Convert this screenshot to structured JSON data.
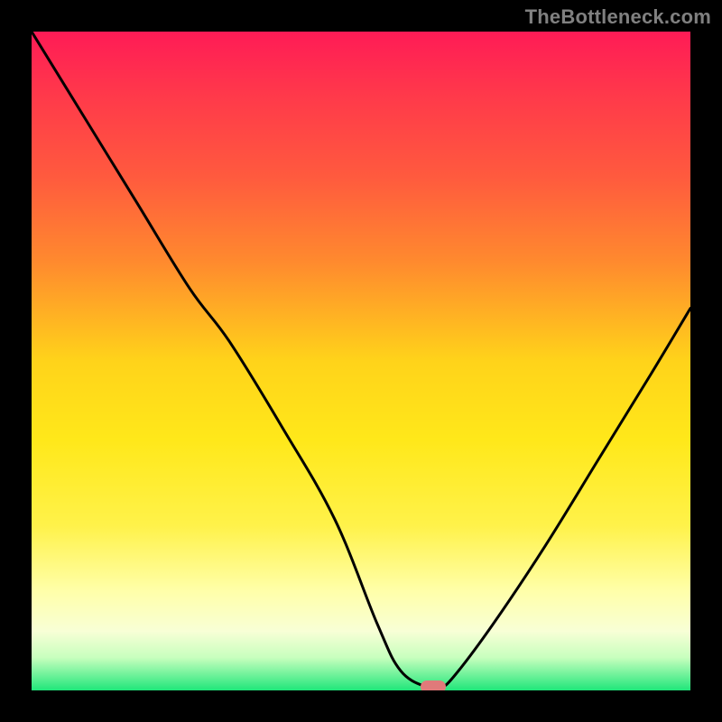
{
  "watermark": {
    "text": "TheBottleneck.com"
  },
  "colors": {
    "black": "#000000",
    "curve": "#000000",
    "marker": "#e07a7a",
    "gradient_stops": [
      {
        "pct": 0,
        "color": "#ff1b56"
      },
      {
        "pct": 10,
        "color": "#ff3a4a"
      },
      {
        "pct": 22,
        "color": "#ff5a3e"
      },
      {
        "pct": 35,
        "color": "#ff8a2e"
      },
      {
        "pct": 50,
        "color": "#ffd31a"
      },
      {
        "pct": 62,
        "color": "#ffe81a"
      },
      {
        "pct": 75,
        "color": "#fff24a"
      },
      {
        "pct": 85,
        "color": "#ffffaa"
      },
      {
        "pct": 91,
        "color": "#f8ffd6"
      },
      {
        "pct": 95,
        "color": "#c8ffbe"
      },
      {
        "pct": 100,
        "color": "#20e67a"
      }
    ]
  },
  "chart_data": {
    "type": "line",
    "title": "",
    "xlabel": "",
    "ylabel": "",
    "xlim": [
      0,
      100
    ],
    "ylim": [
      0,
      100
    ],
    "series": [
      {
        "name": "bottleneck-curve",
        "x": [
          0,
          8,
          16,
          24,
          30,
          38,
          46,
          52.5,
          56,
          60,
          62,
          64,
          70,
          78,
          86,
          94,
          100
        ],
        "values": [
          100,
          87,
          74,
          61,
          53,
          40,
          26,
          10,
          3,
          0.5,
          0.5,
          2,
          10,
          22,
          35,
          48,
          58
        ]
      }
    ],
    "annotations": [
      {
        "name": "optimal-marker",
        "x": 61,
        "y": 0.5
      }
    ],
    "legend": null,
    "grid": false
  }
}
